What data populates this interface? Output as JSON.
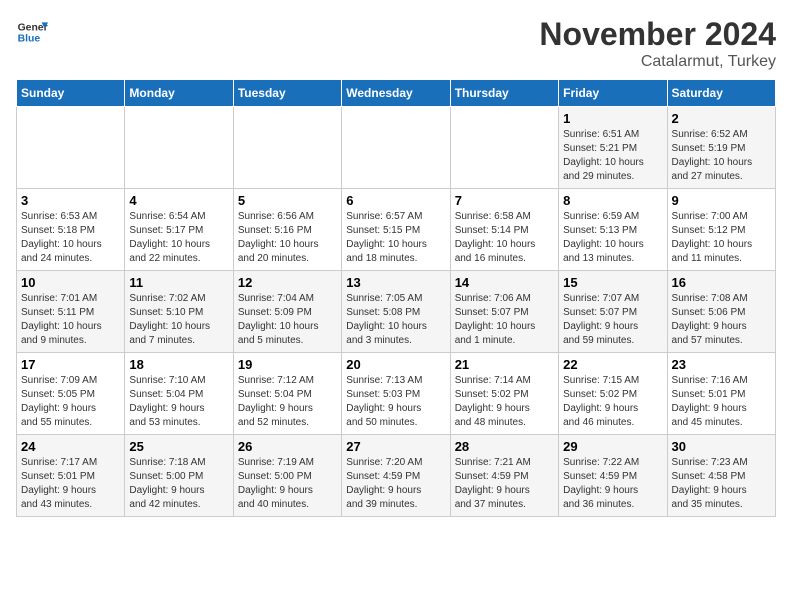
{
  "header": {
    "logo_line1": "General",
    "logo_line2": "Blue",
    "title": "November 2024",
    "subtitle": "Catalarmut, Turkey"
  },
  "calendar": {
    "days_of_week": [
      "Sunday",
      "Monday",
      "Tuesday",
      "Wednesday",
      "Thursday",
      "Friday",
      "Saturday"
    ],
    "weeks": [
      [
        {
          "day": "",
          "info": ""
        },
        {
          "day": "",
          "info": ""
        },
        {
          "day": "",
          "info": ""
        },
        {
          "day": "",
          "info": ""
        },
        {
          "day": "",
          "info": ""
        },
        {
          "day": "1",
          "info": "Sunrise: 6:51 AM\nSunset: 5:21 PM\nDaylight: 10 hours\nand 29 minutes."
        },
        {
          "day": "2",
          "info": "Sunrise: 6:52 AM\nSunset: 5:19 PM\nDaylight: 10 hours\nand 27 minutes."
        }
      ],
      [
        {
          "day": "3",
          "info": "Sunrise: 6:53 AM\nSunset: 5:18 PM\nDaylight: 10 hours\nand 24 minutes."
        },
        {
          "day": "4",
          "info": "Sunrise: 6:54 AM\nSunset: 5:17 PM\nDaylight: 10 hours\nand 22 minutes."
        },
        {
          "day": "5",
          "info": "Sunrise: 6:56 AM\nSunset: 5:16 PM\nDaylight: 10 hours\nand 20 minutes."
        },
        {
          "day": "6",
          "info": "Sunrise: 6:57 AM\nSunset: 5:15 PM\nDaylight: 10 hours\nand 18 minutes."
        },
        {
          "day": "7",
          "info": "Sunrise: 6:58 AM\nSunset: 5:14 PM\nDaylight: 10 hours\nand 16 minutes."
        },
        {
          "day": "8",
          "info": "Sunrise: 6:59 AM\nSunset: 5:13 PM\nDaylight: 10 hours\nand 13 minutes."
        },
        {
          "day": "9",
          "info": "Sunrise: 7:00 AM\nSunset: 5:12 PM\nDaylight: 10 hours\nand 11 minutes."
        }
      ],
      [
        {
          "day": "10",
          "info": "Sunrise: 7:01 AM\nSunset: 5:11 PM\nDaylight: 10 hours\nand 9 minutes."
        },
        {
          "day": "11",
          "info": "Sunrise: 7:02 AM\nSunset: 5:10 PM\nDaylight: 10 hours\nand 7 minutes."
        },
        {
          "day": "12",
          "info": "Sunrise: 7:04 AM\nSunset: 5:09 PM\nDaylight: 10 hours\nand 5 minutes."
        },
        {
          "day": "13",
          "info": "Sunrise: 7:05 AM\nSunset: 5:08 PM\nDaylight: 10 hours\nand 3 minutes."
        },
        {
          "day": "14",
          "info": "Sunrise: 7:06 AM\nSunset: 5:07 PM\nDaylight: 10 hours\nand 1 minute."
        },
        {
          "day": "15",
          "info": "Sunrise: 7:07 AM\nSunset: 5:07 PM\nDaylight: 9 hours\nand 59 minutes."
        },
        {
          "day": "16",
          "info": "Sunrise: 7:08 AM\nSunset: 5:06 PM\nDaylight: 9 hours\nand 57 minutes."
        }
      ],
      [
        {
          "day": "17",
          "info": "Sunrise: 7:09 AM\nSunset: 5:05 PM\nDaylight: 9 hours\nand 55 minutes."
        },
        {
          "day": "18",
          "info": "Sunrise: 7:10 AM\nSunset: 5:04 PM\nDaylight: 9 hours\nand 53 minutes."
        },
        {
          "day": "19",
          "info": "Sunrise: 7:12 AM\nSunset: 5:04 PM\nDaylight: 9 hours\nand 52 minutes."
        },
        {
          "day": "20",
          "info": "Sunrise: 7:13 AM\nSunset: 5:03 PM\nDaylight: 9 hours\nand 50 minutes."
        },
        {
          "day": "21",
          "info": "Sunrise: 7:14 AM\nSunset: 5:02 PM\nDaylight: 9 hours\nand 48 minutes."
        },
        {
          "day": "22",
          "info": "Sunrise: 7:15 AM\nSunset: 5:02 PM\nDaylight: 9 hours\nand 46 minutes."
        },
        {
          "day": "23",
          "info": "Sunrise: 7:16 AM\nSunset: 5:01 PM\nDaylight: 9 hours\nand 45 minutes."
        }
      ],
      [
        {
          "day": "24",
          "info": "Sunrise: 7:17 AM\nSunset: 5:01 PM\nDaylight: 9 hours\nand 43 minutes."
        },
        {
          "day": "25",
          "info": "Sunrise: 7:18 AM\nSunset: 5:00 PM\nDaylight: 9 hours\nand 42 minutes."
        },
        {
          "day": "26",
          "info": "Sunrise: 7:19 AM\nSunset: 5:00 PM\nDaylight: 9 hours\nand 40 minutes."
        },
        {
          "day": "27",
          "info": "Sunrise: 7:20 AM\nSunset: 4:59 PM\nDaylight: 9 hours\nand 39 minutes."
        },
        {
          "day": "28",
          "info": "Sunrise: 7:21 AM\nSunset: 4:59 PM\nDaylight: 9 hours\nand 37 minutes."
        },
        {
          "day": "29",
          "info": "Sunrise: 7:22 AM\nSunset: 4:59 PM\nDaylight: 9 hours\nand 36 minutes."
        },
        {
          "day": "30",
          "info": "Sunrise: 7:23 AM\nSunset: 4:58 PM\nDaylight: 9 hours\nand 35 minutes."
        }
      ]
    ]
  }
}
